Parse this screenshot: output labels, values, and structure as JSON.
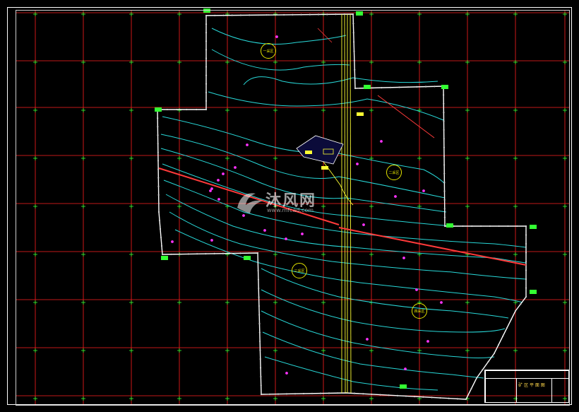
{
  "drawing": {
    "title_block_title": "矿 区 平 面 图",
    "zone_labels": [
      "一采区",
      "二采区",
      "三采区",
      "四采区"
    ],
    "watermark_text": "沐风网",
    "watermark_url": "www.mfcad.com",
    "notes": "",
    "boundary_note": ""
  },
  "colors": {
    "background": "#000000",
    "grid": "#ff2020",
    "grid_cross": "#33ff33",
    "contour": "#28d7d7",
    "boundary": "#ffffff",
    "boundary_dots": "#d8d8d8",
    "road": "#ffff33",
    "fault": "#ff3a3a",
    "survey_point": "#ff33ff",
    "tag": "#33ff33"
  },
  "icons": {
    "logo": "mfcad-logo-icon"
  }
}
